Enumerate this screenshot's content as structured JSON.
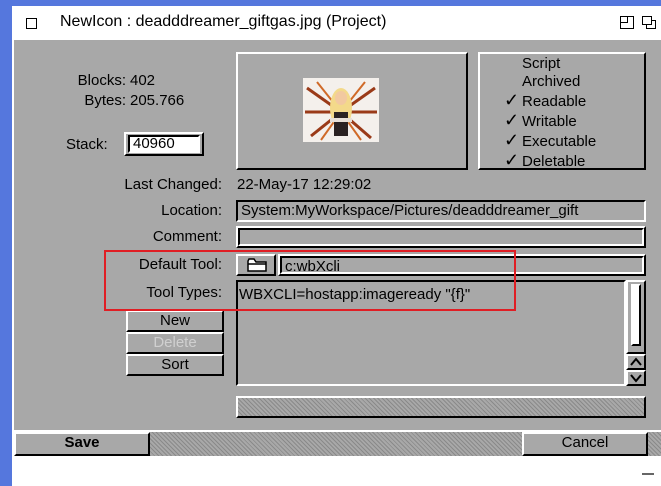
{
  "window": {
    "title": "NewIcon : deadddreamer_giftgas.jpg (Project)"
  },
  "file_info": {
    "blocks_label": "Blocks:",
    "blocks_value": "402",
    "bytes_label": "Bytes:",
    "bytes_value": "205.766",
    "stack_label": "Stack:",
    "stack_value": "40960"
  },
  "protection": {
    "flags": [
      {
        "label": "Script",
        "checked": false
      },
      {
        "label": "Archived",
        "checked": false
      },
      {
        "label": "Readable",
        "checked": true
      },
      {
        "label": "Writable",
        "checked": true
      },
      {
        "label": "Executable",
        "checked": true
      },
      {
        "label": "Deletable",
        "checked": true
      }
    ]
  },
  "details": {
    "last_changed_label": "Last Changed:",
    "last_changed_value": "22-May-17 12:29:02",
    "location_label": "Location:",
    "location_value": "System:MyWorkspace/Pictures/deadddreamer_gift",
    "comment_label": "Comment:",
    "comment_value": "",
    "default_tool_label": "Default Tool:",
    "default_tool_value": "c:wbXcli",
    "tool_types_label": "Tool Types:"
  },
  "tool_types": {
    "items": [
      "WBXCLI=hostapp:imageready \"{f}\""
    ],
    "new_label": "New",
    "delete_label": "Delete",
    "sort_label": "Sort"
  },
  "footer": {
    "save_label": "Save",
    "cancel_label": "Cancel"
  }
}
